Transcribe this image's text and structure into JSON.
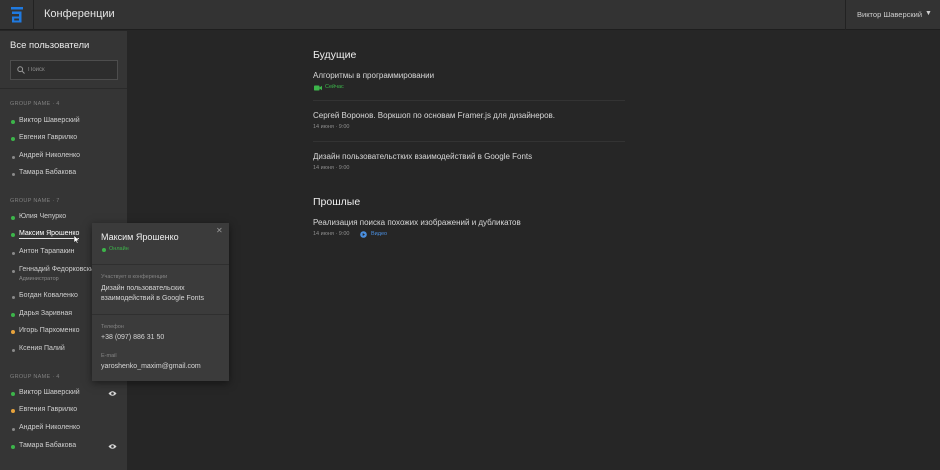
{
  "header": {
    "title": "Конференции",
    "user_name": "Виктор Шаверский",
    "caret": "▼"
  },
  "sidebar": {
    "title": "Все пользователи",
    "search_placeholder": "Поиск",
    "groups": [
      {
        "label": "GROUP NAME · 4",
        "users": [
          {
            "name": "Виктор Шаверский",
            "status": "online"
          },
          {
            "name": "Евгения Гаврилко",
            "status": "online"
          },
          {
            "name": "Андрей Николенко",
            "status": "offline"
          },
          {
            "name": "Тамара Бабакова",
            "status": "offline"
          }
        ]
      },
      {
        "label": "GROUP NAME · 7",
        "users": [
          {
            "name": "Юлия Чепурко",
            "status": "online"
          },
          {
            "name": "Максим Ярошенко",
            "status": "online"
          },
          {
            "name": "Антон Тарапакин",
            "status": "offline"
          },
          {
            "name": "Геннадий Федорковский",
            "role": "Администратор",
            "status": "offline"
          },
          {
            "name": "Богдан Коваленко",
            "status": "offline"
          },
          {
            "name": "Дарья Заривная",
            "status": "online"
          },
          {
            "name": "Игорь Пархоменко",
            "status": "away"
          },
          {
            "name": "Ксения Палий",
            "status": "offline"
          }
        ]
      },
      {
        "label": "GROUP NAME · 4",
        "users": [
          {
            "name": "Виктор Шаверский",
            "status": "online"
          },
          {
            "name": "Евгения Гаврилко",
            "status": "away"
          },
          {
            "name": "Андрей Николенко",
            "status": "offline"
          },
          {
            "name": "Тамара Бабакова",
            "status": "online"
          }
        ]
      }
    ]
  },
  "popover": {
    "close": "✕",
    "name": "Максим Ярошенко",
    "status": "Онлайн",
    "participates_label": "Участвует в конференции",
    "participates_value": "Дизайн пользовательских взаимодействий в Google Fonts",
    "phone_label": "Телефон",
    "phone_value": "+38 (097) 886 31 50",
    "email_label": "E-mail",
    "email_value": "yaroshenko_maxim@gmail.com"
  },
  "main": {
    "upcoming_title": "Будущие",
    "upcoming": [
      {
        "title": "Алгоритмы в программировании",
        "live": "Сейчас"
      },
      {
        "title": "Сергей Воронов. Воркшоп по основам Framer.js для дизайнеров.",
        "meta": "14 июня · 9:00"
      },
      {
        "title": "Дизайн пользовательстких взаимодействий в Google Fonts",
        "meta": "14 июня · 9:00"
      }
    ],
    "past_title": "Прошлые",
    "past": [
      {
        "title": "Реализация поиска похожих изображений и дубликатов",
        "meta": "14 июня · 9:00",
        "video": "Видео"
      }
    ]
  },
  "colors": {
    "online": "#3cb54a",
    "away": "#e8a33c",
    "offline": "#8a8a8a",
    "accent": "#1f7ae0",
    "link": "#4a8fe0"
  },
  "icons": {
    "logo": "brand-logo-icon",
    "search": "search-icon",
    "eye": "eye-icon",
    "live": "video-camera-icon",
    "video": "play-circle-icon",
    "close": "close-icon",
    "caret": "chevron-down-icon"
  }
}
